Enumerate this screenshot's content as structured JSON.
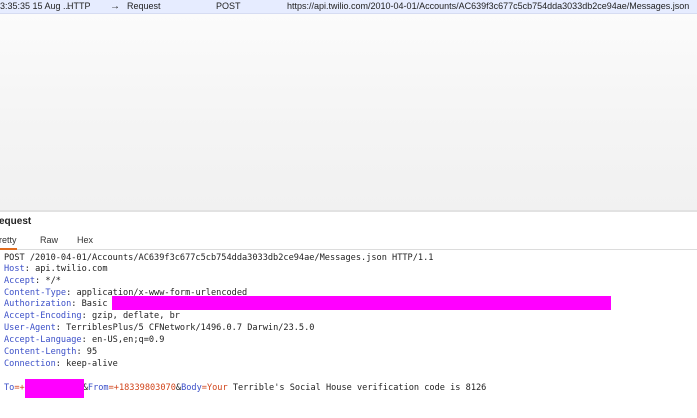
{
  "history": {
    "time": "3:35:35 15 Aug ...",
    "protocol": "HTTP",
    "arrow": "→",
    "type": "Request",
    "method": "POST",
    "url": "https://api.twilio.com/2010-04-01/Accounts/AC639f3c677c5cb754dda3033db2ce94ae/Messages.json"
  },
  "panel": {
    "title": "equest",
    "tabs": [
      "retty",
      "Raw",
      "Hex"
    ]
  },
  "request": {
    "request_line": "POST /2010-04-01/Accounts/AC639f3c677c5cb754dda3033db2ce94ae/Messages.json HTTP/1.1",
    "headers": [
      {
        "name": "Host",
        "value": "api.twilio.com"
      },
      {
        "name": "Accept",
        "value": "*/*"
      },
      {
        "name": "Content-Type",
        "value": "application/x-www-form-urlencoded"
      },
      {
        "name": "Authorization",
        "value": "Basic"
      },
      {
        "name": "Accept-Encoding",
        "value": "gzip, deflate, br"
      },
      {
        "name": "User-Agent",
        "value": "TerriblesPlus/5 CFNetwork/1496.0.7 Darwin/23.5.0"
      },
      {
        "name": "Accept-Language",
        "value": "en-US,en;q=0.9"
      },
      {
        "name": "Content-Length",
        "value": "95"
      },
      {
        "name": "Connection",
        "value": "keep-alive"
      }
    ],
    "body": {
      "to_key": "To",
      "to_prefix": "=+",
      "from_sep": "&",
      "from_key": "From",
      "from_value": "=+18339803070",
      "body_sep": "&",
      "body_key": "Body",
      "body_eq": "=",
      "body_your": "Your",
      "body_rest": " Terrible's Social House verification code is 8126"
    }
  },
  "colors": {
    "redaction": "#ff00ff",
    "header_name": "#3b4fc8",
    "param_value": "#d1441a",
    "selection": "#e6ecff",
    "active_tab": "#e06c1f"
  }
}
